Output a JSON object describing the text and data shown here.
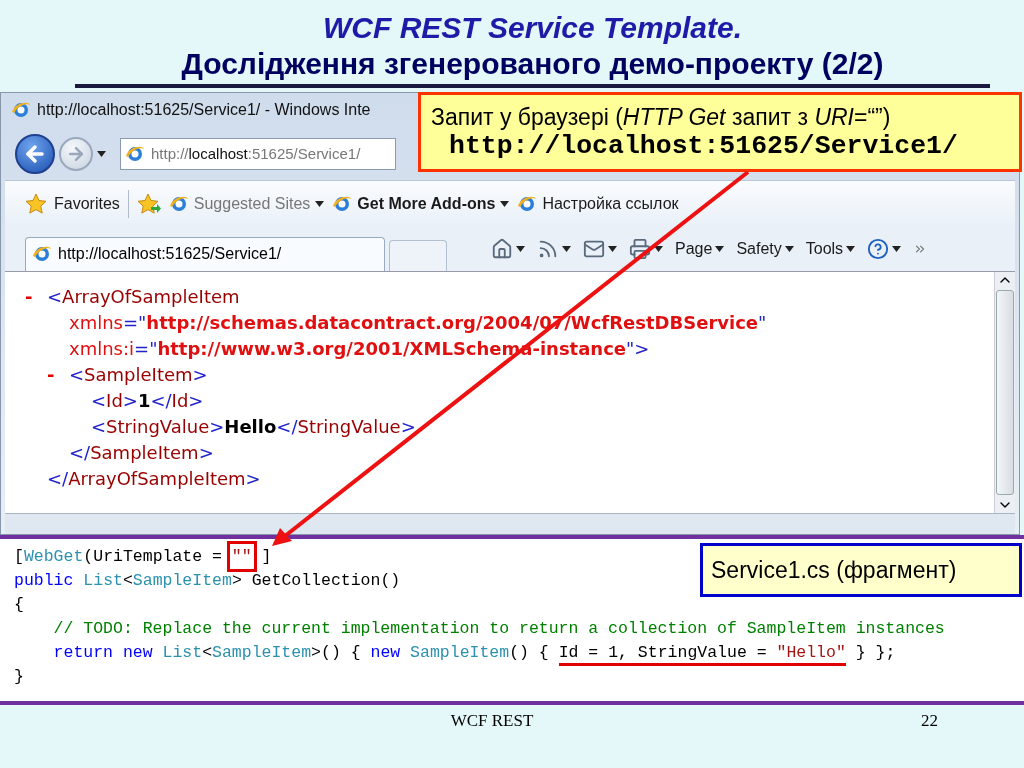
{
  "slide": {
    "title_line1": "WCF REST Service Template.",
    "title_line2": "Дослідження згенерованого демо-проекту (2/2)"
  },
  "browser": {
    "title": "http://localhost:51625/Service1/ - Windows Inte",
    "address": "http://**localhost**:51625/Service1/",
    "favorites_bar": [
      {
        "kind": "favorites",
        "label": "Favorites"
      },
      {
        "kind": "muted",
        "label": "Suggested Sites"
      },
      {
        "kind": "bold",
        "label": "Get More Add-ons"
      },
      {
        "kind": "plain",
        "label": "Настройка ссылок"
      }
    ],
    "tab": {
      "title": "http://localhost:51625/Service1/",
      "selected": true
    },
    "commands": [
      {
        "kind": "home"
      },
      {
        "kind": "feeds"
      },
      {
        "kind": "mail"
      },
      {
        "kind": "print"
      },
      {
        "kind": "menu",
        "label": "Page"
      },
      {
        "kind": "menu",
        "label": "Safety"
      },
      {
        "kind": "menu",
        "label": "Tools"
      },
      {
        "kind": "help"
      }
    ],
    "xml": {
      "toggle": "-",
      "open": [
        [
          {
            "text": "<",
            "kind": "bracket"
          },
          {
            "text": "ArrayOfSampleItem",
            "kind": "tag"
          }
        ],
        [
          {
            "text": "xmlns",
            "kind": "attr"
          },
          {
            "text": "=\"",
            "kind": "bracket"
          },
          {
            "text": "http://schemas.datacontract.org/2004/07/WcfRestDBService",
            "kind": "value"
          },
          {
            "text": "\"",
            "kind": "bracket"
          }
        ],
        [
          {
            "text": "xmlns:i",
            "kind": "attr"
          },
          {
            "text": "=\"",
            "kind": "bracket"
          },
          {
            "text": "http://www.w3.org/2001/XMLSchema-instance",
            "kind": "value"
          },
          {
            "text": "\">",
            "kind": "bracket"
          }
        ]
      ],
      "close": [
        {
          "text": "</",
          "kind": "bracket"
        },
        {
          "text": "ArrayOfSampleItem",
          "kind": "tag"
        },
        {
          "text": ">",
          "kind": "bracket"
        }
      ],
      "children": [
        {
          "toggle": "-",
          "open": [
            [
              {
                "text": "<",
                "kind": "bracket"
              },
              {
                "text": "SampleItem",
                "kind": "tag"
              },
              {
                "text": ">",
                "kind": "bracket"
              }
            ]
          ],
          "close": [
            {
              "text": "</",
              "kind": "bracket"
            },
            {
              "text": "SampleItem",
              "kind": "tag"
            },
            {
              "text": ">",
              "kind": "bracket"
            }
          ],
          "children": [
            {
              "line": [
                {
                  "text": "<",
                  "kind": "bracket"
                },
                {
                  "text": "Id",
                  "kind": "tag"
                },
                {
                  "text": ">",
                  "kind": "bracket"
                },
                {
                  "text": "1",
                  "kind": "text"
                },
                {
                  "text": "</",
                  "kind": "bracket"
                },
                {
                  "text": "Id",
                  "kind": "tag"
                },
                {
                  "text": ">",
                  "kind": "bracket"
                }
              ]
            },
            {
              "line": [
                {
                  "text": "<",
                  "kind": "bracket"
                },
                {
                  "text": "StringValue",
                  "kind": "tag"
                },
                {
                  "text": ">",
                  "kind": "bracket"
                },
                {
                  "text": "Hello",
                  "kind": "text"
                },
                {
                  "text": "</",
                  "kind": "bracket"
                },
                {
                  "text": "StringValue",
                  "kind": "tag"
                },
                {
                  "text": ">",
                  "kind": "bracket"
                }
              ]
            }
          ]
        }
      ]
    }
  },
  "request_callout": {
    "text": "Запит у браузері (*HTTP Get* запит з *URI*=“”)",
    "url": "http://localhost:51625/Service1/"
  },
  "code_callout": {
    "text": "Service1.cs (фрагмент)"
  },
  "code": [
    [
      {
        "text": "[",
        "kind": "plain"
      },
      {
        "text": "WebGet",
        "kind": "type"
      },
      {
        "text": "(UriTemplate = ",
        "kind": "plain"
      },
      {
        "text": "\"\"",
        "kind": "string",
        "boxed": true
      },
      {
        "text": " ]",
        "kind": "plain"
      }
    ],
    [
      {
        "text": "public",
        "kind": "keyword"
      },
      {
        "text": " List",
        "kind": "type"
      },
      {
        "text": "<",
        "kind": "plain"
      },
      {
        "text": "SampleItem",
        "kind": "type"
      },
      {
        "text": "> GetCollection()",
        "kind": "plain"
      }
    ],
    [
      {
        "text": "{",
        "kind": "plain"
      }
    ],
    [
      {
        "text": "    // TODO: Replace the current implementation to return a collection of SampleItem instances",
        "kind": "comment"
      }
    ],
    [
      {
        "text": "    return new",
        "kind": "keyword"
      },
      {
        "text": " List",
        "kind": "type"
      },
      {
        "text": "<",
        "kind": "plain"
      },
      {
        "text": "SampleItem",
        "kind": "type"
      },
      {
        "text": ">() { ",
        "kind": "plain"
      },
      {
        "text": "new",
        "kind": "keyword"
      },
      {
        "text": " SampleItem",
        "kind": "type"
      },
      {
        "text": "() { ",
        "kind": "plain"
      },
      {
        "underlined": true,
        "tokens": [
          {
            "text": "Id = 1, StringValue = ",
            "kind": "plain"
          },
          {
            "text": "\"Hello\"",
            "kind": "string"
          }
        ]
      },
      {
        "text": " } };",
        "kind": "plain"
      }
    ],
    [
      {
        "text": "}",
        "kind": "plain"
      }
    ]
  ],
  "footer": {
    "text": "WCF REST",
    "page_number": "22"
  }
}
